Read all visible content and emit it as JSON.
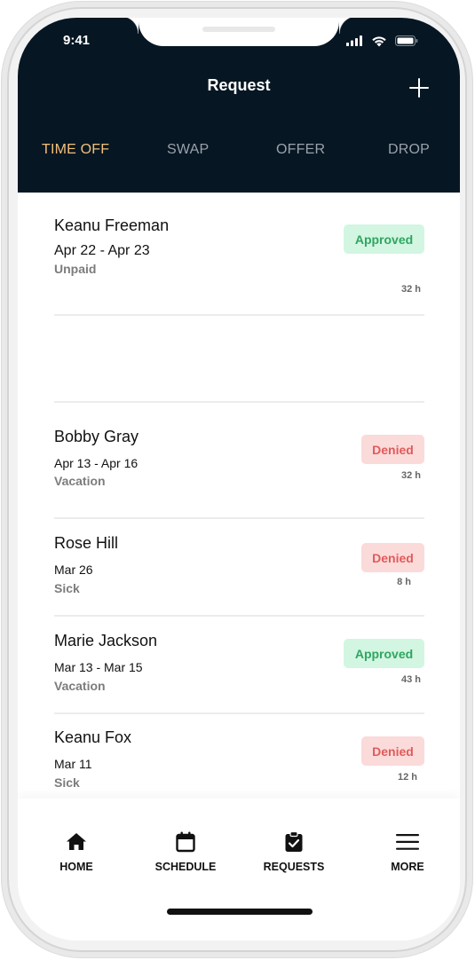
{
  "status_bar": {
    "time": "9:41"
  },
  "header": {
    "title": "Request"
  },
  "tabs": [
    {
      "label": "TIME OFF",
      "active": true
    },
    {
      "label": "SWAP",
      "active": false
    },
    {
      "label": "OFFER",
      "active": false
    },
    {
      "label": "DROP",
      "active": false
    }
  ],
  "requests": [
    {
      "name": "Keanu Freeman",
      "dates": "Apr 22 - Apr 23",
      "type": "Unpaid",
      "status": "Approved",
      "hours": "32 h"
    },
    {
      "name": "Bobby Gray",
      "dates": "Apr 13 - Apr 16",
      "type": "Vacation",
      "status": "Denied",
      "hours": "32 h"
    },
    {
      "name": "Rose Hill",
      "dates": "Mar 26",
      "type": "Sick",
      "status": "Denied",
      "hours": "8 h"
    },
    {
      "name": "Marie Jackson",
      "dates": "Mar 13 - Mar 15",
      "type": "Vacation",
      "status": "Approved",
      "hours": "43 h"
    },
    {
      "name": "Keanu Fox",
      "dates": "Mar 11",
      "type": "Sick",
      "status": "Denied",
      "hours": "12 h"
    }
  ],
  "bottom_nav": [
    {
      "label": "HOME",
      "icon": "home-icon"
    },
    {
      "label": "SCHEDULE",
      "icon": "calendar-icon"
    },
    {
      "label": "REQUESTS",
      "icon": "clipboard-check-icon"
    },
    {
      "label": "MORE",
      "icon": "menu-icon"
    }
  ],
  "colors": {
    "header_bg": "#061623",
    "tab_active": "#f2c07a",
    "tab_inactive": "#9aa2ab",
    "approved_bg": "#d2f6e1",
    "approved_text": "#2fa561",
    "denied_bg": "#fbdada",
    "denied_text": "#e05b5b"
  }
}
